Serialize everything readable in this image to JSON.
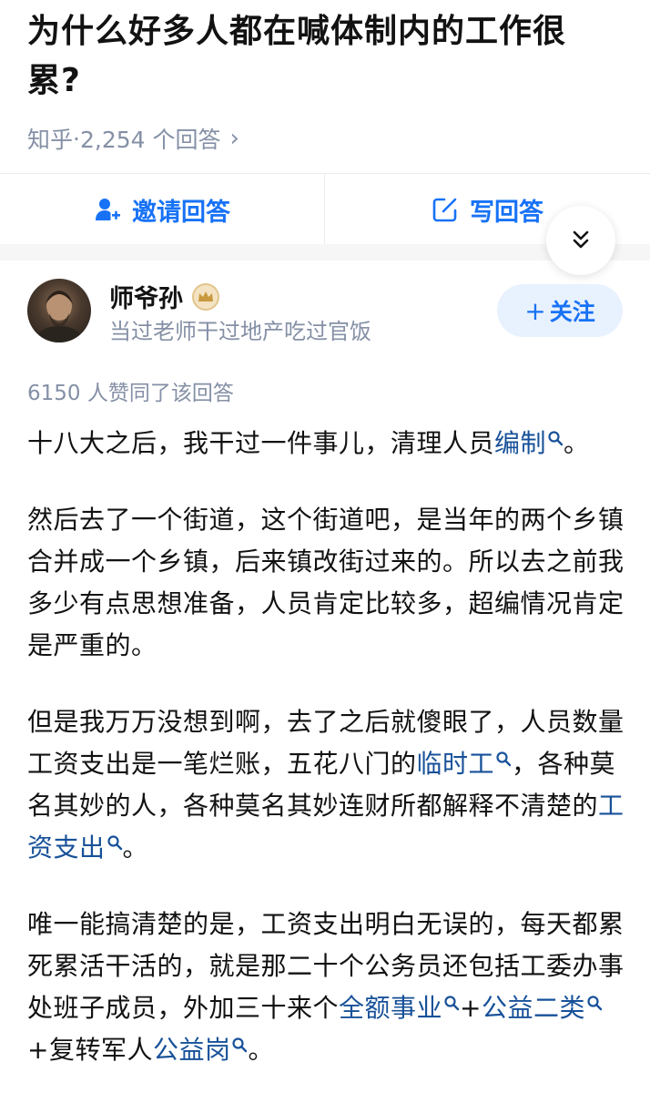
{
  "question": {
    "title": "为什么好多人都在喊体制内的工作很累?",
    "source": "知乎",
    "separator": " · ",
    "answer_count": "2,254 个回答"
  },
  "actions": {
    "invite_label": "邀请回答",
    "write_label": "写回答"
  },
  "author": {
    "name": "师爷孙",
    "bio": "当过老师干过地产吃过官饭",
    "follow_label": "关注",
    "follow_plus": "+"
  },
  "answer": {
    "votes": "6150 人赞同了该回答",
    "paragraphs": [
      [
        {
          "t": "十八大之后，我干过一件事儿，清理人员"
        },
        {
          "t": "编制",
          "kw": true
        },
        {
          "t": "。"
        }
      ],
      [
        {
          "t": "然后去了一个街道，这个街道吧，是当年的两个乡镇合并成一个乡镇，后来镇改街过来的。所以去之前我多少有点思想准备，人员肯定比较多，超编情况肯定是严重的。"
        }
      ],
      [
        {
          "t": "但是我万万没想到啊，去了之后就傻眼了，人员数量工资支出是一笔烂账，五花八门的"
        },
        {
          "t": "临时工",
          "kw": true
        },
        {
          "t": "，各种莫名其妙的人，各种莫名其妙连财所都解释不清楚的"
        },
        {
          "t": "工资支出",
          "kw": true
        },
        {
          "t": "。"
        }
      ],
      [
        {
          "t": "唯一能搞清楚的是，工资支出明白无误的，每天都累死累活干活的，就是那二十个公务员还包括工委办事处班子成员，外加三十来个"
        },
        {
          "t": "全额事业",
          "kw": true
        },
        {
          "t": "+"
        },
        {
          "t": "公益二类",
          "kw": true
        },
        {
          "t": "+复转军人"
        },
        {
          "t": "公益岗",
          "kw": true
        },
        {
          "t": "。"
        }
      ]
    ]
  },
  "colors": {
    "accent": "#1772f6",
    "link": "#175199",
    "muted": "#8590a6",
    "text": "#121212"
  },
  "icons": [
    "invite-user-icon",
    "edit-icon",
    "double-chevron-down-icon",
    "chevron-right-icon",
    "search-icon",
    "crown-badge-icon"
  ]
}
